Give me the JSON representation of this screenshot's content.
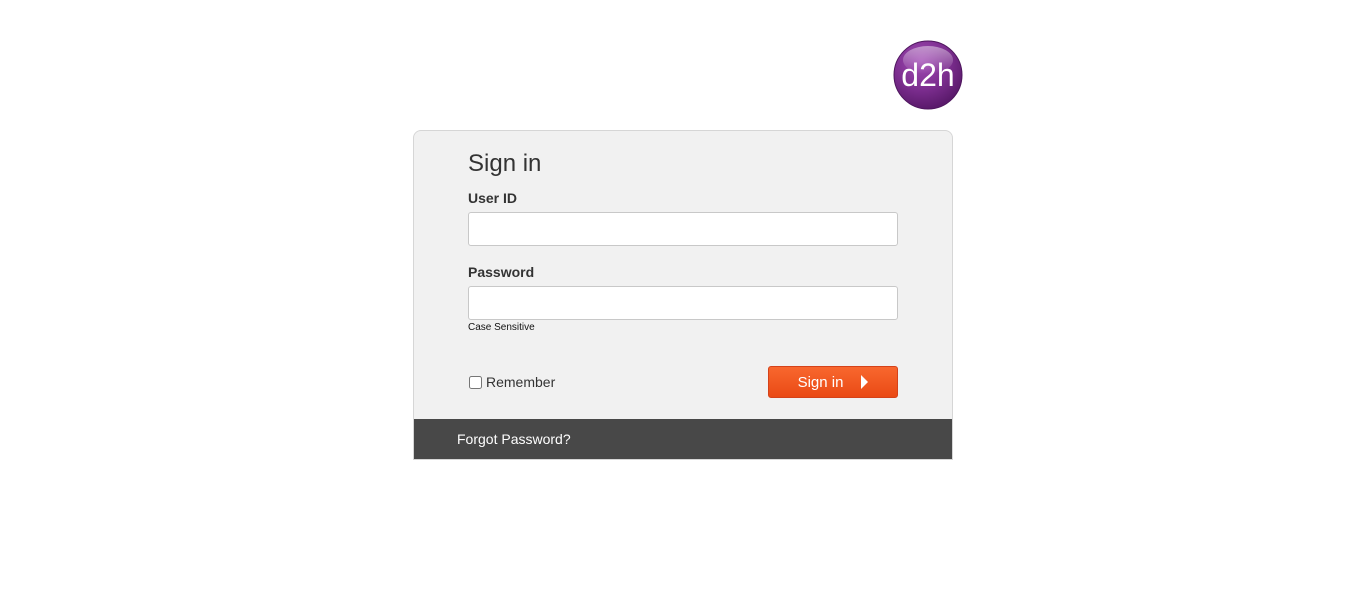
{
  "brand": {
    "logo_text": "d2h",
    "logo_color": "#7b2d8e"
  },
  "form": {
    "title": "Sign in",
    "user_id_label": "User ID",
    "user_id_value": "",
    "password_label": "Password",
    "password_value": "",
    "password_hint": "Case Sensitive",
    "remember_label": "Remember",
    "remember_checked": false,
    "submit_label": "Sign in",
    "submit_icon": "arrow-right-icon",
    "submit_color": "#f05a22"
  },
  "footer": {
    "forgot_password_label": "Forgot Password?",
    "background_color": "#484848"
  }
}
